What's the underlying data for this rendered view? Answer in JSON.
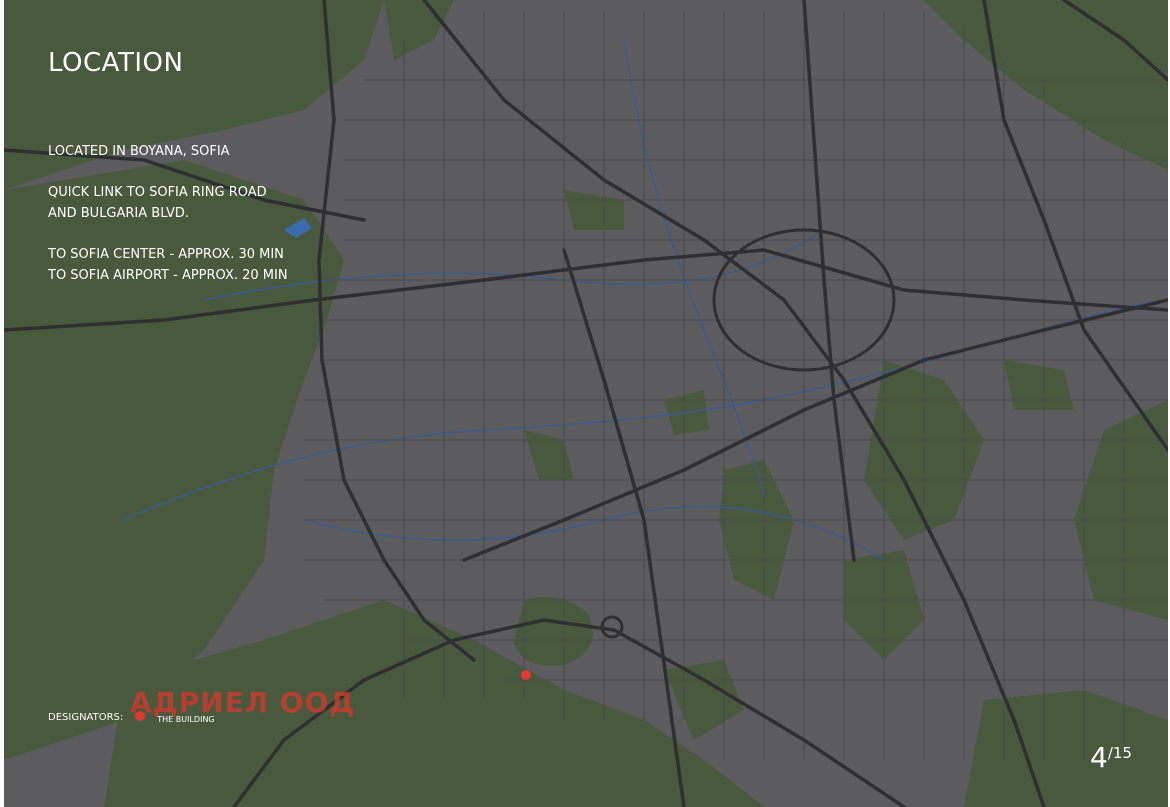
{
  "page": {
    "title": "LOCATION",
    "info": {
      "line1": "LOCATED IN BOYANA, SOFIA",
      "line2a": "QUICK LINK TO SOFIA RING ROAD",
      "line2b": "AND BULGARIA BLVD.",
      "line3a": "TO SOFIA CENTER - APPROX. 30 MIN",
      "line3b": "TO SOFIA AIRPORT - APPROX. 20 MIN"
    },
    "legend": {
      "label": "DESIGNATORS:",
      "building_label": "THE BUILDING",
      "marker_color": "#e23a2e"
    },
    "watermark": "АДРИЕЛ ООД",
    "pagination": {
      "current": "4",
      "total": "/15"
    }
  },
  "map": {
    "type": "city street map",
    "city": "Sofia",
    "colors": {
      "urban": "#5c5c5e",
      "green": "#48593d",
      "roads": "#343436",
      "water": "#3a5a90",
      "marker": "#e23a2e"
    }
  }
}
